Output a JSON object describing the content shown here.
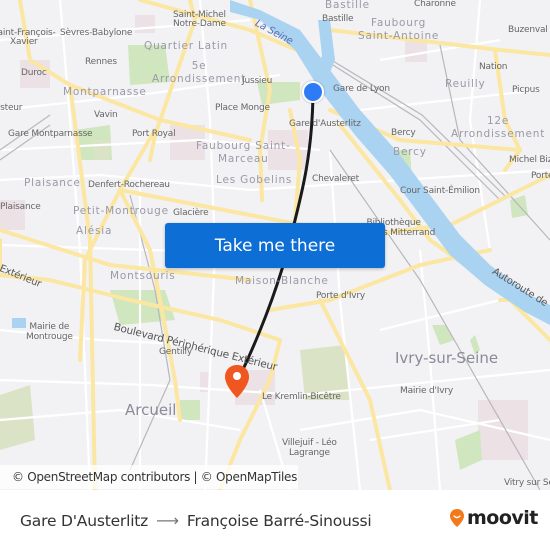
{
  "map": {
    "colors": {
      "background": "#f2f2f4",
      "water": "#aad3f2",
      "park": "#c4e3b4",
      "road_major": "#fbe6a2",
      "route_line": "#1a1a1a",
      "origin_marker": "#2d7cf5",
      "destination_marker": "#f0561f",
      "button": "#0d6fd6"
    },
    "labels": {
      "saint_michel": "Saint-Michel\nNotre-Dame",
      "saint_francois": "Saint-François-\nXavier",
      "sevres_babylone": "Sèvres-Babylone",
      "quartier_latin": "Quartier Latin",
      "rennes": "Rennes",
      "fifth_arr": "5e\nArrondissement",
      "duroc": "Duroc",
      "jussieu": "Jussieu",
      "montparnasse": "Montparnasse",
      "pasteur": "Pasteur",
      "place_monge": "Place Monge",
      "vavin": "Vavin",
      "gare_montparnasse": "Gare Montparnasse",
      "port_royal": "Port Royal",
      "la_seine": "La Seine",
      "bastille_district": "Bastille",
      "bastille": "Bastille",
      "charonne": "Charonne",
      "faubourg_st_antoine": "Faubourg\nSaint-Antoine",
      "buzenval": "Buzenval",
      "nation": "Nation",
      "gare_de_lyon": "Gare de Lyon",
      "reuilly": "Reuilly",
      "picpus": "Picpus",
      "gare_austerlitz": "Gare d'Austerlitz",
      "twelfth_arr": "12e\nArrondissement",
      "bercy_station": "Bercy",
      "bercy": "Bercy",
      "faubourg_st_marceau": "Faubourg Saint-\nMarceau",
      "michel_bizot": "Michel Bizot",
      "porte_doree": "Porte",
      "plaisance_district": "Plaisance",
      "denfert": "Denfert-Rochereau",
      "les_gobelins": "Les Gobelins",
      "chevaleret": "Chevaleret",
      "cour_st_emilion": "Cour Saint-Émilion",
      "plaisance": "Plaisance",
      "petit_montrouge": "Petit-Montrouge",
      "glaciere": "Glacière",
      "bibliotheque": "Bibliothèque\nFrançois Mitterrand",
      "alesia": "Alésia",
      "montsouris": "Montsouris",
      "maison_blanche": "Maison-Blanche",
      "exterieur": "Extérieur",
      "autoroute": "Autoroute de",
      "porte_ivry": "Porte d'Ivry",
      "mairie_montrouge": "Mairie de\nMontrouge",
      "boulevard_peripherique": "Boulevard Périphérique Extérieur",
      "gentilly": "Gentilly",
      "ivry": "Ivry-sur-Seine",
      "mairie_ivry": "Mairie d'Ivry",
      "kremlin": "Le Kremlin-Bicêtre",
      "arcueil": "Arcueil",
      "villejuif": "Villejuif - Léo\nLagrange",
      "vitry": "Vitry sur Seine"
    },
    "cta_label": "Take me there",
    "attribution": "© OpenStreetMap contributors | © OpenMapTiles"
  },
  "route": {
    "origin": "Gare D'Austerlitz",
    "destination": "Françoise Barré-Sinoussi",
    "arrow": "⟶"
  },
  "brand": {
    "name": "moovit"
  }
}
